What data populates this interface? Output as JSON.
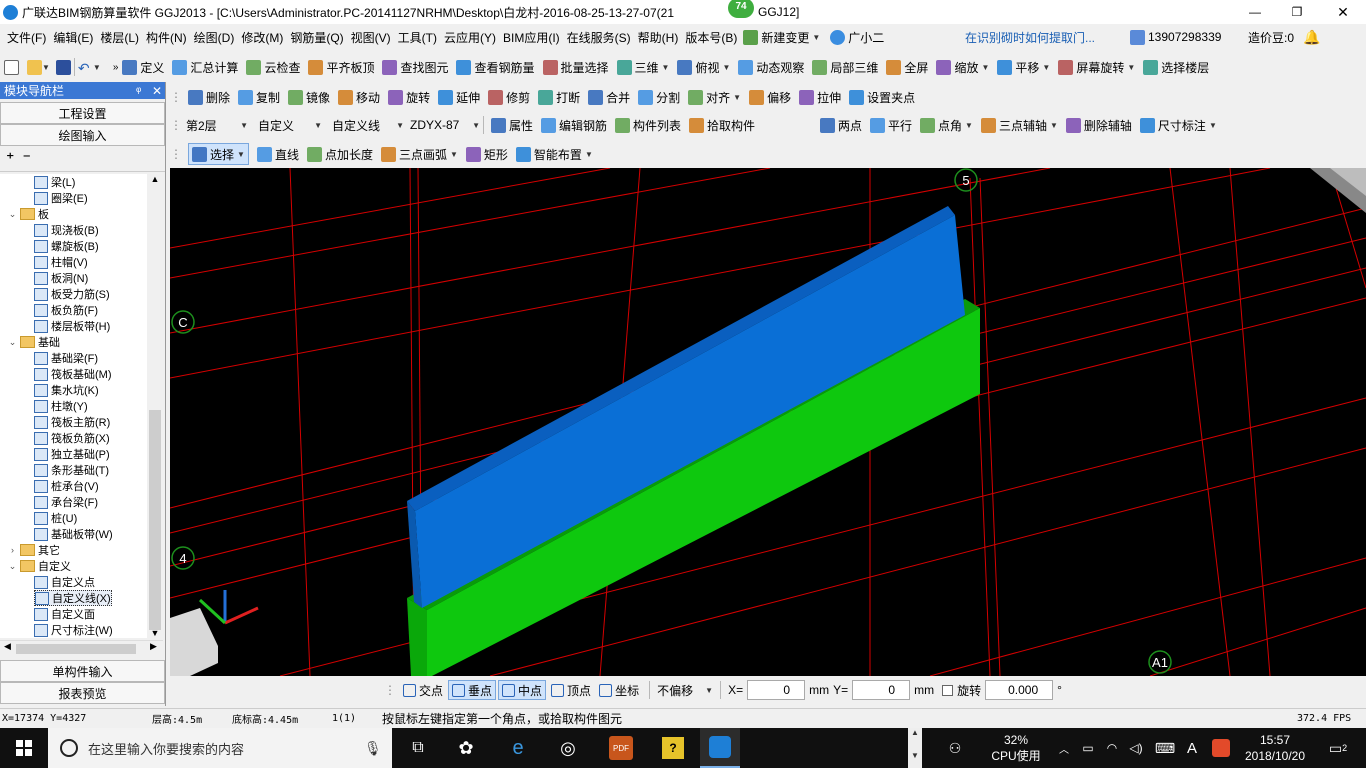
{
  "title": {
    "text": "广联达BIM钢筋算量软件 GGJ2013 - [C:\\Users\\Administrator.PC-20141127NRHM\\Desktop\\白龙村-2016-08-25-13-27-07(21",
    "suffix": "GGJ12]",
    "badge": "74",
    "min": "—",
    "max": "❐",
    "close": "✕"
  },
  "menu": {
    "items": [
      "文件(F)",
      "编辑(E)",
      "楼层(L)",
      "构件(N)",
      "绘图(D)",
      "修改(M)",
      "钢筋量(Q)",
      "视图(V)",
      "工具(T)",
      "云应用(Y)",
      "BIM应用(I)",
      "在线服务(S)",
      "帮助(H)",
      "版本号(B)"
    ],
    "new_change": "新建变更",
    "assistant": "广小二",
    "marquee": "在识别砌时如何提取门...",
    "phone": "13907298339",
    "beans": "造价豆:0"
  },
  "toolbar1": [
    "定义",
    "汇总计算",
    "云检查",
    "平齐板顶",
    "查找图元",
    "查看钢筋量",
    "批量选择",
    "三维",
    "俯视",
    "动态观察",
    "局部三维",
    "全屏",
    "缩放",
    "平移",
    "屏幕旋转",
    "选择楼层"
  ],
  "toolbar2": [
    "删除",
    "复制",
    "镜像",
    "移动",
    "旋转",
    "延伸",
    "修剪",
    "打断",
    "合并",
    "分割",
    "对齐",
    "偏移",
    "拉伸",
    "设置夹点"
  ],
  "toolbar3": {
    "floor": "第2层",
    "type": "自定义",
    "subtype": "自定义线",
    "name": "ZDYX-87",
    "items": [
      "属性",
      "编辑钢筋",
      "构件列表",
      "拾取构件"
    ],
    "right": [
      "两点",
      "平行",
      "点角",
      "三点辅轴",
      "删除辅轴",
      "尺寸标注"
    ]
  },
  "toolbar4": [
    "选择",
    "直线",
    "点加长度",
    "三点画弧",
    "矩形",
    "智能布置"
  ],
  "nav": {
    "title": "模块导航栏",
    "pin": "ᵠ",
    "close": "✕",
    "project_settings": "工程设置",
    "drawing_input": "绘图输入",
    "single_input": "单构件输入",
    "report": "报表预览",
    "tree": [
      {
        "label": "梁(L)",
        "level": 2
      },
      {
        "label": "圈梁(E)",
        "level": 2
      },
      {
        "label": "板",
        "level": 1,
        "folder": true
      },
      {
        "label": "现浇板(B)",
        "level": 2
      },
      {
        "label": "螺旋板(B)",
        "level": 2
      },
      {
        "label": "柱帽(V)",
        "level": 2
      },
      {
        "label": "板洞(N)",
        "level": 2
      },
      {
        "label": "板受力筋(S)",
        "level": 2
      },
      {
        "label": "板负筋(F)",
        "level": 2
      },
      {
        "label": "楼层板带(H)",
        "level": 2
      },
      {
        "label": "基础",
        "level": 1,
        "folder": true
      },
      {
        "label": "基础梁(F)",
        "level": 2
      },
      {
        "label": "筏板基础(M)",
        "level": 2
      },
      {
        "label": "集水坑(K)",
        "level": 2
      },
      {
        "label": "柱墩(Y)",
        "level": 2
      },
      {
        "label": "筏板主筋(R)",
        "level": 2
      },
      {
        "label": "筏板负筋(X)",
        "level": 2
      },
      {
        "label": "独立基础(P)",
        "level": 2
      },
      {
        "label": "条形基础(T)",
        "level": 2
      },
      {
        "label": "桩承台(V)",
        "level": 2
      },
      {
        "label": "承台梁(F)",
        "level": 2
      },
      {
        "label": "桩(U)",
        "level": 2
      },
      {
        "label": "基础板带(W)",
        "level": 2
      },
      {
        "label": "其它",
        "level": 1,
        "folder": true,
        "collapsed": true
      },
      {
        "label": "自定义",
        "level": 1,
        "folder": true
      },
      {
        "label": "自定义点",
        "level": 2
      },
      {
        "label": "自定义线(X)",
        "level": 2,
        "selected": true
      },
      {
        "label": "自定义面",
        "level": 2
      },
      {
        "label": "尺寸标注(W)",
        "level": 2
      }
    ]
  },
  "viewport": {
    "axis_labels": [
      "5",
      "C",
      "4",
      "A1"
    ],
    "colors": {
      "top_block": "#0a6fd6",
      "bottom_block": "#0ec80e",
      "grid": "#e00000",
      "bg": "#000000"
    }
  },
  "snap_bar": {
    "items": [
      "交点",
      "垂点",
      "中点",
      "顶点",
      "坐标"
    ],
    "offset": "不偏移",
    "x_label": "X=",
    "x_value": "0",
    "y_label": "Y=",
    "y_value": "0",
    "unit": "mm",
    "rotate_label": "旋转",
    "rotate_value": "0.000",
    "degree": "°"
  },
  "status": {
    "coords": "X=17374 Y=4327",
    "floor_height": "层高:4.5m",
    "bottom_height": "底标高:4.45m",
    "count": "1(1)",
    "hint": "按鼠标左键指定第一个角点，或拾取构件图元",
    "fps": "372.4 FPS"
  },
  "taskbar": {
    "search": "在这里输入你要搜索的内容",
    "cpu_pct": "32%",
    "cpu_label": "CPU使用",
    "ime": "A",
    "time": "15:57",
    "date": "2018/10/20",
    "notif": "2"
  }
}
